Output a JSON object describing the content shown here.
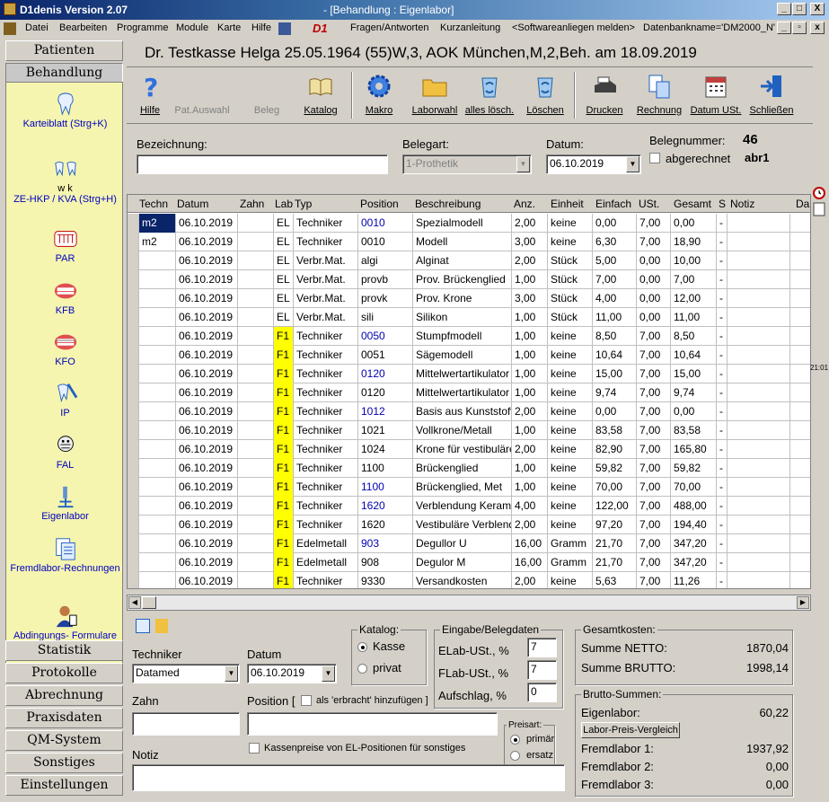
{
  "window": {
    "app_title": "D1denis Version 2.07",
    "doc_title": "- [Behandlung : Eigenlabor]",
    "btn_min": "_",
    "btn_max": "□",
    "btn_close": "X"
  },
  "menu": {
    "items": [
      "Datei",
      "Bearbeiten",
      "Programme",
      "Module",
      "Karte",
      "Hilfe"
    ],
    "logo": "D1",
    "right_items": [
      "Fragen/Antworten",
      "Kurzanleitung",
      "<Softwareanliegen melden>",
      "Datenbankname='DM2000_N'"
    ]
  },
  "sidebar": {
    "top_buttons": [
      "Patienten",
      "Behandlung"
    ],
    "items": [
      {
        "label": "Karteiblatt (Strg+K)",
        "icon": "tooth-icon"
      },
      {
        "label": "ZE-HKP / KVA (Strg+H)",
        "icon": "teeth-icon",
        "sub": "w   k"
      },
      {
        "label": "PAR",
        "icon": "par-icon"
      },
      {
        "label": "KFB",
        "icon": "mouth-icon"
      },
      {
        "label": "KFO",
        "icon": "mouth-icon"
      },
      {
        "label": "IP",
        "icon": "toothbrush-icon"
      },
      {
        "label": "FAL",
        "icon": "head-icon"
      },
      {
        "label": "Eigenlabor",
        "icon": "microscope-icon"
      },
      {
        "label": "Fremdlabor-Rechnungen",
        "icon": "documents-icon"
      },
      {
        "label": "Abdingungs- Formulare",
        "icon": "person-icon"
      }
    ],
    "bottom_buttons": [
      "Statistik",
      "Protokolle",
      "Abrechnung",
      "Praxisdaten",
      "QM-System",
      "Sonstiges",
      "Einstellungen"
    ]
  },
  "patient_title": "Dr. Testkasse Helga  25.05.1964  (55)W,3, AOK München,M,2,Beh. am 18.09.2019",
  "toolbar": [
    {
      "label": "Hilfe",
      "icon": "help-icon",
      "enabled": true
    },
    {
      "label": "Pat.Auswahl",
      "icon": "patient-select-icon",
      "enabled": false
    },
    {
      "label": "Beleg",
      "icon": "receipt-icon",
      "enabled": false
    },
    {
      "label": "Katalog",
      "icon": "book-icon",
      "enabled": true
    },
    {
      "label": "Makro",
      "icon": "gear-icon",
      "enabled": true
    },
    {
      "label": "Laborwahl",
      "icon": "folder-icon",
      "enabled": true
    },
    {
      "label": "alles lösch.",
      "icon": "recycle-icon",
      "enabled": true
    },
    {
      "label": "Löschen",
      "icon": "recycle-icon",
      "enabled": true
    },
    {
      "label": "Drucken",
      "icon": "printer-icon",
      "enabled": true
    },
    {
      "label": "Rechnung",
      "icon": "invoice-icon",
      "enabled": true
    },
    {
      "label": "Datum USt.",
      "icon": "calendar-icon",
      "enabled": true
    },
    {
      "label": "Schließen",
      "icon": "exit-icon",
      "enabled": true
    }
  ],
  "form": {
    "bezeichnung_label": "Bezeichnung:",
    "bezeichnung_value": "",
    "belegart_label": "Belegart:",
    "belegart_value": "1-Prothetik",
    "datum_label": "Datum:",
    "datum_value": "06.10.2019",
    "belegnummer_label": "Belegnummer:",
    "belegnummer_value": "46",
    "abgerechnet_label": "abgerechnet",
    "abgerechnet_value": "abr1"
  },
  "grid": {
    "columns": [
      "Techn",
      "Datum",
      "Zahn",
      "Lab",
      "Typ",
      "Position",
      "Beschreibung",
      "Anz.",
      "Einheit",
      "Einfach",
      "USt.",
      "Gesamt",
      "S",
      "Notiz",
      "Da"
    ],
    "rows": [
      [
        "m2",
        "06.10.2019",
        "",
        "EL",
        "Techniker",
        "0010",
        "Spezialmodell",
        "2,00",
        "keine",
        "0,00",
        "7,00",
        "0,00",
        "-"
      ],
      [
        "m2",
        "06.10.2019",
        "",
        "EL",
        "Techniker",
        "0010",
        "Modell",
        "3,00",
        "keine",
        "6,30",
        "7,00",
        "18,90",
        "-"
      ],
      [
        "",
        "06.10.2019",
        "",
        "EL",
        "Verbr.Mat.",
        "algi",
        "Alginat",
        "2,00",
        "Stück",
        "5,00",
        "0,00",
        "10,00",
        "-"
      ],
      [
        "",
        "06.10.2019",
        "",
        "EL",
        "Verbr.Mat.",
        "provb",
        "Prov. Brückenglied",
        "1,00",
        "Stück",
        "7,00",
        "0,00",
        "7,00",
        "-"
      ],
      [
        "",
        "06.10.2019",
        "",
        "EL",
        "Verbr.Mat.",
        "provk",
        "Prov. Krone",
        "3,00",
        "Stück",
        "4,00",
        "0,00",
        "12,00",
        "-"
      ],
      [
        "",
        "06.10.2019",
        "",
        "EL",
        "Verbr.Mat.",
        "sili",
        "Silikon",
        "1,00",
        "Stück",
        "11,00",
        "0,00",
        "11,00",
        "-"
      ],
      [
        "",
        "06.10.2019",
        "",
        "F1",
        "Techniker",
        "0050",
        "Stumpfmodell",
        "1,00",
        "keine",
        "8,50",
        "7,00",
        "8,50",
        "-"
      ],
      [
        "",
        "06.10.2019",
        "",
        "F1",
        "Techniker",
        "0051",
        "Sägemodell",
        "1,00",
        "keine",
        "10,64",
        "7,00",
        "10,64",
        "-"
      ],
      [
        "",
        "06.10.2019",
        "",
        "F1",
        "Techniker",
        "0120",
        "Mittelwertartikulator",
        "1,00",
        "keine",
        "15,00",
        "7,00",
        "15,00",
        "-"
      ],
      [
        "",
        "06.10.2019",
        "",
        "F1",
        "Techniker",
        "0120",
        "Mittelwertartikulator",
        "1,00",
        "keine",
        "9,74",
        "7,00",
        "9,74",
        "-"
      ],
      [
        "",
        "06.10.2019",
        "",
        "F1",
        "Techniker",
        "1012",
        "Basis aus Kunststoff",
        "2,00",
        "keine",
        "0,00",
        "7,00",
        "0,00",
        "-"
      ],
      [
        "",
        "06.10.2019",
        "",
        "F1",
        "Techniker",
        "1021",
        "Vollkrone/Metall",
        "1,00",
        "keine",
        "83,58",
        "7,00",
        "83,58",
        "-"
      ],
      [
        "",
        "06.10.2019",
        "",
        "F1",
        "Techniker",
        "1024",
        "Krone für vestibuläre",
        "2,00",
        "keine",
        "82,90",
        "7,00",
        "165,80",
        "-"
      ],
      [
        "",
        "06.10.2019",
        "",
        "F1",
        "Techniker",
        "1100",
        "Brückenglied",
        "1,00",
        "keine",
        "59,82",
        "7,00",
        "59,82",
        "-"
      ],
      [
        "",
        "06.10.2019",
        "",
        "F1",
        "Techniker",
        "1100",
        "Brückenglied, Met",
        "1,00",
        "keine",
        "70,00",
        "7,00",
        "70,00",
        "-"
      ],
      [
        "",
        "06.10.2019",
        "",
        "F1",
        "Techniker",
        "1620",
        "Verblendung Keramik",
        "4,00",
        "keine",
        "122,00",
        "7,00",
        "488,00",
        "-"
      ],
      [
        "",
        "06.10.2019",
        "",
        "F1",
        "Techniker",
        "1620",
        "Vestibuläre Verblendung",
        "2,00",
        "keine",
        "97,20",
        "7,00",
        "194,40",
        "-"
      ],
      [
        "",
        "06.10.2019",
        "",
        "F1",
        "Edelmetall",
        "903",
        "Degullor U",
        "16,00",
        "Gramm",
        "21,70",
        "7,00",
        "347,20",
        "-"
      ],
      [
        "",
        "06.10.2019",
        "",
        "F1",
        "Edelmetall",
        "908",
        "Degulor M",
        "16,00",
        "Gramm",
        "21,70",
        "7,00",
        "347,20",
        "-"
      ],
      [
        "",
        "06.10.2019",
        "",
        "F1",
        "Techniker",
        "9330",
        "Versandkosten",
        "2,00",
        "keine",
        "5,63",
        "7,00",
        "11,26",
        "-"
      ]
    ],
    "blue_positions": [
      0,
      6,
      8,
      10,
      14,
      15,
      17
    ]
  },
  "bottom": {
    "techniker_label": "Techniker",
    "techniker_value": "Datamed",
    "datum_label": "Datum",
    "datum_value": "06.10.2019",
    "katalog_title": "Katalog:",
    "katalog_kasse": "Kasse",
    "katalog_privat": "privat",
    "eingabe_title": "Eingabe/Belegdaten",
    "elab_label": "ELab-USt., %",
    "elab_value": "7",
    "flab_label": "FLab-USt., %",
    "flab_value": "7",
    "aufschlag_label": "Aufschlag, %",
    "aufschlag_value": "0",
    "zahn_label": "Zahn",
    "position_label": "Position [",
    "erbracht_label": "als 'erbracht' hinzufügen ]",
    "kassenpreise_label": "Kassenpreise von EL-Positionen für sonstiges",
    "preisart_title": "Preisart:",
    "preisart_primaer": "primär",
    "preisart_ersatz": "ersatz",
    "notiz_label": "Notiz",
    "gesamt_title": "Gesamtkosten:",
    "netto_label": "Summe NETTO:",
    "netto_value": "1870,04",
    "brutto_label": "Summe BRUTTO:",
    "brutto_value": "1998,14",
    "bs_title": "Brutto-Summen:",
    "eigenlabor_label": "Eigenlabor:",
    "eigenlabor_value": "60,22",
    "preisvergleich_button": "Labor-Preis-Vergleich",
    "fl1_label": "Fremdlabor 1:",
    "fl1_value": "1937,92",
    "fl2_label": "Fremdlabor 2:",
    "fl2_value": "0,00",
    "fl3_label": "Fremdlabor 3:",
    "fl3_value": "0,00"
  },
  "right_edge_time": "21:01"
}
